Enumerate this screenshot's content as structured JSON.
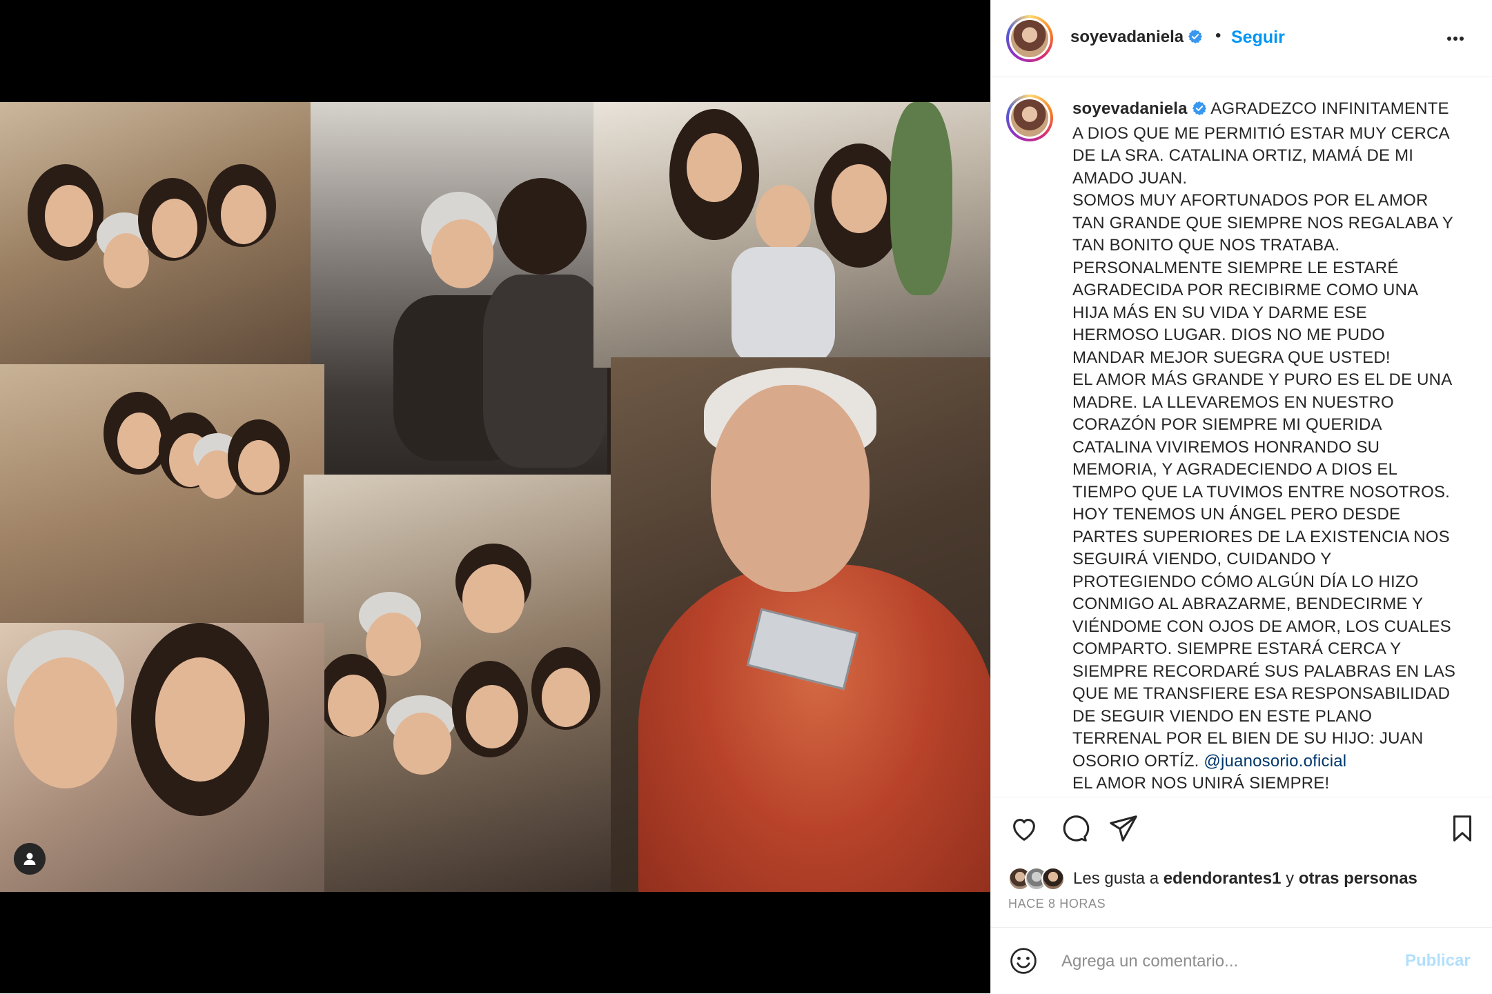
{
  "post": {
    "username": "soyevadaniela",
    "verified": true,
    "follow_label": "Seguir",
    "separator": "•",
    "caption_lines": [
      "AGRADEZCO INFINITAMENTE",
      "A DIOS QUE ME PERMITIÓ ESTAR MUY CERCA",
      "DE LA SRA. CATALINA ORTIZ, MAMÁ DE MI",
      "AMADO JUAN.",
      "SOMOS MUY AFORTUNADOS POR EL AMOR",
      "TAN GRANDE QUE SIEMPRE NOS REGALABA Y",
      "TAN BONITO QUE NOS TRATABA.",
      "PERSONALMENTE SIEMPRE LE ESTARÉ",
      "AGRADECIDA POR RECIBIRME COMO UNA",
      "HIJA MÁS EN SU VIDA Y DARME ESE",
      "HERMOSO LUGAR. DIOS NO ME PUDO",
      "MANDAR MEJOR SUEGRA QUE USTED!",
      "EL AMOR MÁS GRANDE Y PURO ES EL DE UNA",
      "MADRE. LA LLEVAREMOS EN NUESTRO",
      "CORAZÓN POR SIEMPRE MI QUERIDA",
      "CATALINA VIVIREMOS HONRANDO SU",
      "MEMORIA, Y AGRADECIENDO A DIOS EL",
      "TIEMPO QUE LA TUVIMOS ENTRE NOSOTROS.",
      "HOY TENEMOS UN ÁNGEL PERO DESDE",
      "PARTES SUPERIORES DE LA EXISTENCIA NOS",
      "SEGUIRÁ VIENDO, CUIDANDO Y",
      "PROTEGIENDO CÓMO ALGÚN DÍA LO HIZO",
      "CONMIGO AL ABRAZARME, BENDECIRME Y",
      "VIÉNDOME CON OJOS DE AMOR, LOS CUALES",
      "COMPARTO. SIEMPRE ESTARÁ CERCA Y",
      "SIEMPRE RECORDARÉ SUS PALABRAS EN LAS",
      "QUE ME TRANSFIERE ESA RESPONSABILIDAD",
      "DE SEGUIR VIENDO EN ESTE PLANO",
      "TERRENAL POR EL BIEN DE SU HIJO: JUAN",
      "OSORIO ORTÍZ."
    ],
    "mention": "@juanosorio.oficial",
    "closing_line": "EL AMOR NOS UNIRÁ SIEMPRE!",
    "likes_prefix": "Les gusta a",
    "likes_user": "edendorantes1",
    "likes_connector": "y",
    "likes_others": "otras personas",
    "timestamp": "HACE 8 HORAS",
    "comment_placeholder": "Agrega un comentario...",
    "publish_label": "Publicar"
  },
  "icons": {
    "more": "more-options-icon",
    "like": "heart-icon",
    "comment": "comment-icon",
    "share": "paper-plane-icon",
    "save": "bookmark-icon",
    "emoji": "emoji-icon",
    "tagged_user": "user-tag-icon",
    "verified": "verified-badge-icon"
  },
  "colors": {
    "accent": "#0095f6",
    "verified": "#3897f0",
    "mention": "#00376b",
    "muted": "#8e8e8e",
    "publish_disabled": "#b2dffc"
  }
}
